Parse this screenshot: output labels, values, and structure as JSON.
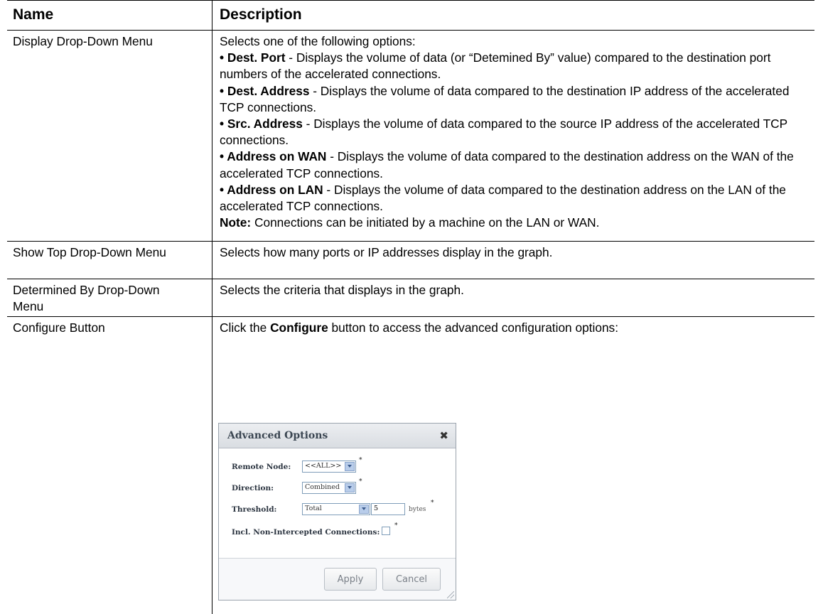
{
  "table": {
    "headers": {
      "name": "Name",
      "description": "Description"
    },
    "rows": [
      {
        "name": "Display Drop-Down Menu",
        "intro": "Selects one of the following options:",
        "options": [
          {
            "term": "Dest. Port",
            "text": " - Displays the volume of data (or “Detemined By” value) compared to the destination port numbers of the accelerated connections."
          },
          {
            "term": "Dest. Address",
            "text": " - Displays the volume of data compared to the destination IP address of the accelerated TCP connections."
          },
          {
            "term": "Src. Address",
            "text": " - Displays the volume of data compared to the source IP address of the accelerated TCP connections."
          },
          {
            "term": "Address on WAN",
            "text": " - Displays the volume of data compared to the destination address on the WAN of the accelerated TCP connections."
          },
          {
            "term": "Address on LAN",
            "text": " - Displays the volume of data compared to the destination address on the LAN of the accelerated TCP connections."
          }
        ],
        "note_label": "Note:",
        "note_text": " Connections can be initiated by a machine on the LAN or WAN."
      },
      {
        "name": "Show Top Drop-Down Menu",
        "description": "Selects how many ports or IP addresses display in the graph."
      },
      {
        "name": "Determined By Drop-Down Menu",
        "description": "Selects the criteria that displays in the graph."
      },
      {
        "name": "Configure Button",
        "desc_pre": "Click the ",
        "desc_bold": "Configure",
        "desc_post": " button to access the advanced configuration options:"
      }
    ]
  },
  "dialog": {
    "title": "Advanced Options",
    "close_icon": "close-icon",
    "remote_node_label": "Remote Node:",
    "remote_node_value": "<<ALL>>",
    "direction_label": "Direction:",
    "direction_value": "Combined",
    "threshold_label": "Threshold:",
    "threshold_value": "Total",
    "threshold_amount": "5",
    "threshold_unit": "bytes",
    "incl_label": "Incl. Non-Intercepted Connections:",
    "apply_label": "Apply",
    "cancel_label": "Cancel",
    "required_mark": "*"
  }
}
